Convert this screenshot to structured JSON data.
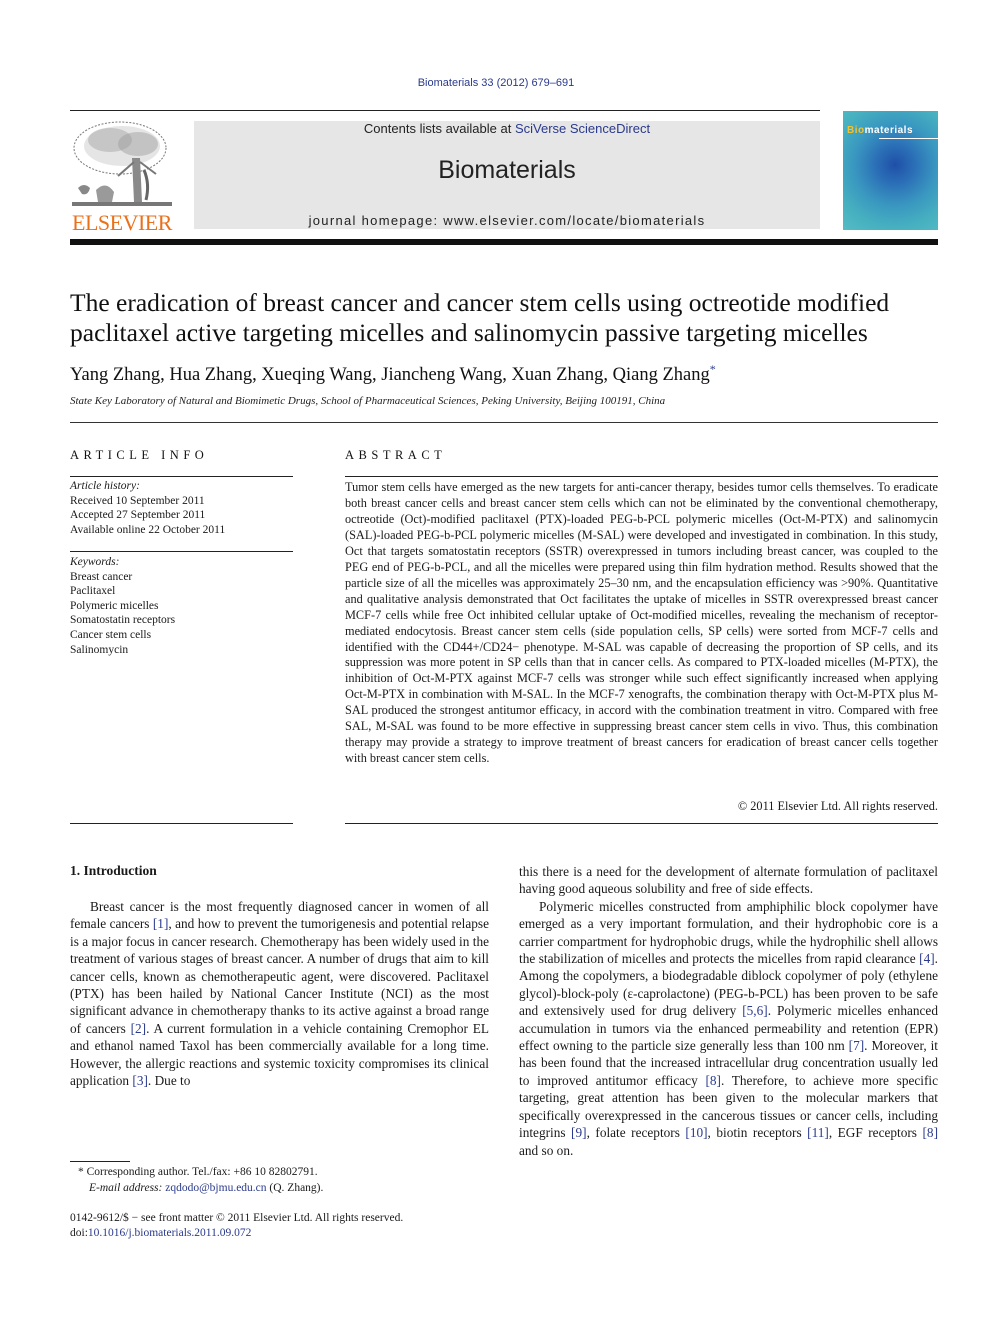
{
  "header": {
    "citation": "Biomaterials 33 (2012) 679–691",
    "contents_prefix": "Contents lists available at ",
    "contents_link": "SciVerse ScienceDirect",
    "journal_title": "Biomaterials",
    "homepage_prefix": "journal homepage: ",
    "homepage_url": "www.elsevier.com/locate/biomaterials",
    "publisher_logo_text": "ELSEVIER",
    "cover_title_accent": "Bio",
    "cover_title_rest": "materials",
    "colors": {
      "link": "#2a3a8c",
      "elsevier_orange": "#e9711c",
      "banner_bg": "#e6e6e6"
    }
  },
  "article": {
    "title": "The eradication of breast cancer and cancer stem cells using octreotide modified paclitaxel active targeting micelles and salinomycin passive targeting micelles",
    "authors": "Yang Zhang, Hua Zhang, Xueqing Wang, Jiancheng Wang, Xuan Zhang, Qiang Zhang",
    "corresponding_marker": "*",
    "affiliation": "State Key Laboratory of Natural and Biomimetic Drugs, School of Pharmaceutical Sciences, Peking University, Beijing 100191, China"
  },
  "article_info": {
    "label": "ARTICLE INFO",
    "history_head": "Article history:",
    "history": [
      "Received 10 September 2011",
      "Accepted 27 September 2011",
      "Available online 22 October 2011"
    ],
    "keywords_head": "Keywords:",
    "keywords": [
      "Breast cancer",
      "Paclitaxel",
      "Polymeric micelles",
      "Somatostatin receptors",
      "Cancer stem cells",
      "Salinomycin"
    ]
  },
  "abstract": {
    "label": "ABSTRACT",
    "text": "Tumor stem cells have emerged as the new targets for anti-cancer therapy, besides tumor cells themselves. To eradicate both breast cancer cells and breast cancer stem cells which can not be eliminated by the conventional chemotherapy, octreotide (Oct)-modified paclitaxel (PTX)-loaded PEG-b-PCL polymeric micelles (Oct-M-PTX) and salinomycin (SAL)-loaded PEG-b-PCL polymeric micelles (M-SAL) were developed and investigated in combination. In this study, Oct that targets somatostatin receptors (SSTR) overexpressed in tumors including breast cancer, was coupled to the PEG end of PEG-b-PCL, and all the micelles were prepared using thin film hydration method. Results showed that the particle size of all the micelles was approximately 25–30 nm, and the encapsulation efficiency was >90%. Quantitative and qualitative analysis demonstrated that Oct facilitates the uptake of micelles in SSTR overexpressed breast cancer MCF-7 cells while free Oct inhibited cellular uptake of Oct-modified micelles, revealing the mechanism of receptor-mediated endocytosis. Breast cancer stem cells (side population cells, SP cells) were sorted from MCF-7 cells and identified with the CD44+/CD24− phenotype. M-SAL was capable of decreasing the proportion of SP cells, and its suppression was more potent in SP cells than that in cancer cells. As compared to PTX-loaded micelles (M-PTX), the inhibition of Oct-M-PTX against MCF-7 cells was stronger while such effect significantly increased when applying Oct-M-PTX in combination with M-SAL. In the MCF-7 xenografts, the combination therapy with Oct-M-PTX plus M-SAL produced the strongest antitumor efficacy, in accord with the combination treatment in vitro. Compared with free SAL, M-SAL was found to be more effective in suppressing breast cancer stem cells in vivo. Thus, this combination therapy may provide a strategy to improve treatment of breast cancers for eradication of breast cancer cells together with breast cancer stem cells.",
    "copyright": "© 2011 Elsevier Ltd. All rights reserved."
  },
  "introduction": {
    "heading": "1.  Introduction",
    "left_col": [
      {
        "t": "Breast cancer is the most frequently diagnosed cancer in women of all female cancers "
      },
      {
        "ref": "[1]"
      },
      {
        "t": ", and how to prevent the tumorigenesis and potential relapse is a major focus in cancer research. Chemotherapy has been widely used in the treatment of various stages of breast cancer. A number of drugs that aim to kill cancer cells, known as chemotherapeutic agent, were discovered. Paclitaxel (PTX) has been hailed by National Cancer Institute (NCI) as the most significant advance in chemotherapy thanks to its active against a broad range of cancers "
      },
      {
        "ref": "[2]"
      },
      {
        "t": ". A current formulation in a vehicle containing Cremophor EL and ethanol named Taxol has been commercially available for a long time. However, the allergic reactions and systemic toxicity compromises its clinical application "
      },
      {
        "ref": "[3]"
      },
      {
        "t": ". Due to"
      }
    ],
    "right_col_p1": "this there is a need for the development of alternate formulation of paclitaxel having good aqueous solubility and free of side effects.",
    "right_col_p2": [
      {
        "t": "Polymeric micelles constructed from amphiphilic block copolymer have emerged as a very important formulation, and their hydrophobic core is a carrier compartment for hydrophobic drugs, while the hydrophilic shell allows the stabilization of micelles and protects the micelles from rapid clearance "
      },
      {
        "ref": "[4]"
      },
      {
        "t": ". Among the copolymers, a biodegradable diblock copolymer of poly (ethylene glycol)-block-poly (ε-caprolactone) (PEG-b-PCL) has been proven to be safe and extensively used for drug delivery "
      },
      {
        "ref": "[5,6]"
      },
      {
        "t": ". Polymeric micelles enhanced accumulation in tumors via the enhanced permeability and retention (EPR) effect owning to the particle size generally less than 100 nm "
      },
      {
        "ref": "[7]"
      },
      {
        "t": ". Moreover, it has been found that the increased intracellular drug concentration usually led to improved antitumor efficacy "
      },
      {
        "ref": "[8]"
      },
      {
        "t": ". Therefore, to achieve more specific targeting, great attention has been given to the molecular markers that specifically overexpressed in the cancerous tissues or cancer cells, including integrins "
      },
      {
        "ref": "[9]"
      },
      {
        "t": ", folate receptors "
      },
      {
        "ref": "[10]"
      },
      {
        "t": ", biotin receptors "
      },
      {
        "ref": "[11]"
      },
      {
        "t": ", EGF receptors "
      },
      {
        "ref": "[8]"
      },
      {
        "t": " and so on."
      }
    ]
  },
  "footnote": {
    "corresponding": "* Corresponding author. Tel./fax: +86 10 82802791.",
    "email_label": "E-mail address: ",
    "email": "zqdodo@bjmu.edu.cn",
    "email_suffix": " (Q. Zhang).",
    "front_matter": "0142-9612/$ − see front matter © 2011 Elsevier Ltd. All rights reserved.",
    "doi_label": "doi:",
    "doi": "10.1016/j.biomaterials.2011.09.072"
  }
}
